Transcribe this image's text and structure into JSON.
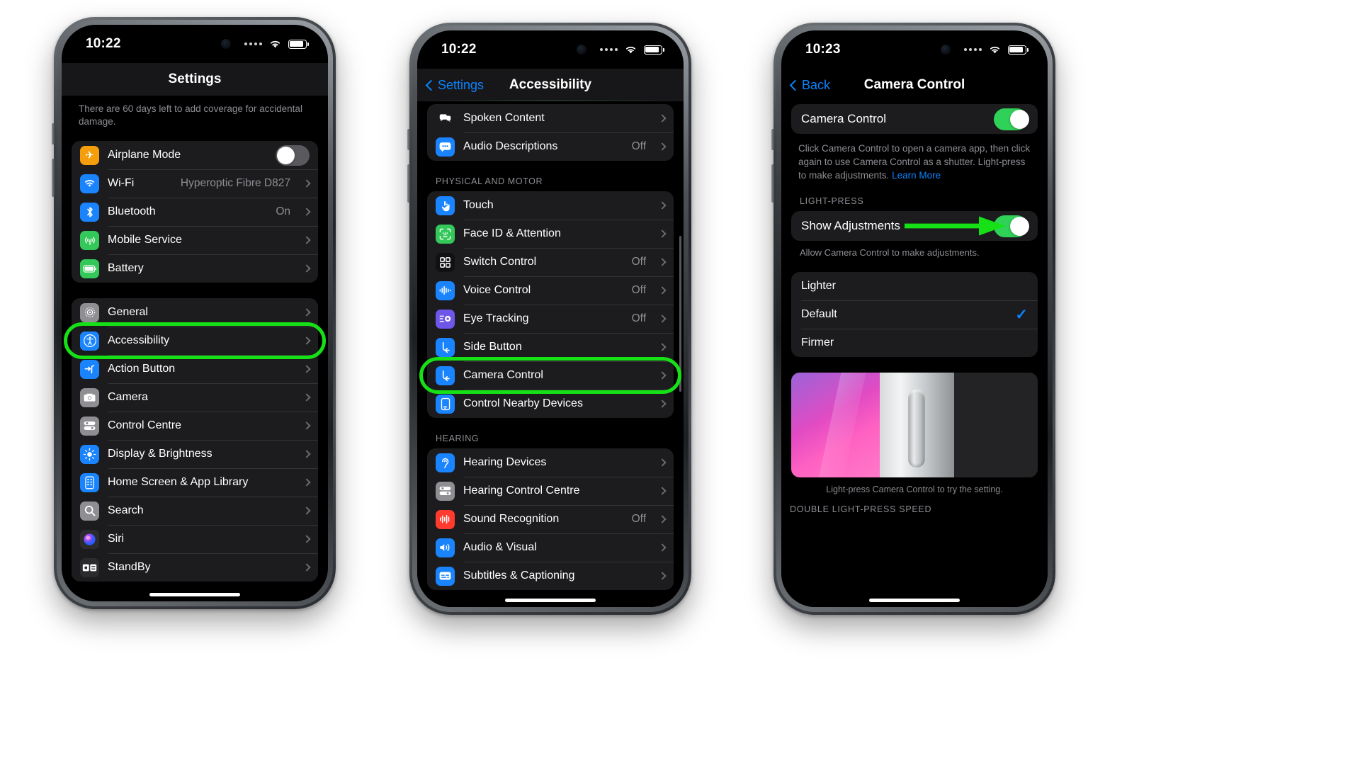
{
  "phone1": {
    "status": {
      "time": "10:22",
      "signal": "cellular-bars",
      "wifi": "wifi-icon",
      "battery": "battery-icon"
    },
    "nav": {
      "title": "Settings"
    },
    "footnote": "There are 60 days left to add coverage for accidental damage.",
    "group_a": [
      {
        "label": "Airplane Mode",
        "icon": "airplane-icon",
        "icon_color": "#f59e0b",
        "control": "toggle",
        "toggle_on": false
      },
      {
        "label": "Wi-Fi",
        "icon": "wifi-icon",
        "icon_color": "#1a84ff",
        "value": "Hyperoptic Fibre D827",
        "control": "chevron"
      },
      {
        "label": "Bluetooth",
        "icon": "bluetooth-icon",
        "icon_color": "#1a84ff",
        "value": "On",
        "control": "chevron"
      },
      {
        "label": "Mobile Service",
        "icon": "antenna-icon",
        "icon_color": "#34c759",
        "value": "",
        "control": "chevron"
      },
      {
        "label": "Battery",
        "icon": "battery-icon",
        "icon_color": "#34c759",
        "value": "",
        "control": "chevron"
      }
    ],
    "group_b": [
      {
        "label": "General",
        "icon": "gear-icon",
        "icon_color": "#8e8e93",
        "control": "chevron"
      },
      {
        "label": "Accessibility",
        "icon": "accessibility-icon",
        "icon_color": "#1a84ff",
        "control": "chevron",
        "highlighted": true
      },
      {
        "label": "Action Button",
        "icon": "action-button-icon",
        "icon_color": "#1a84ff",
        "control": "chevron"
      },
      {
        "label": "Camera",
        "icon": "camera-icon",
        "icon_color": "#8e8e93",
        "control": "chevron"
      },
      {
        "label": "Control Centre",
        "icon": "control-centre-icon",
        "icon_color": "#8e8e93",
        "control": "chevron"
      },
      {
        "label": "Display & Brightness",
        "icon": "brightness-icon",
        "icon_color": "#1a84ff",
        "control": "chevron"
      },
      {
        "label": "Home Screen & App Library",
        "icon": "home-screen-icon",
        "icon_color": "#1a84ff",
        "control": "chevron"
      },
      {
        "label": "Search",
        "icon": "search-icon",
        "icon_color": "#8e8e93",
        "control": "chevron"
      },
      {
        "label": "Siri",
        "icon": "siri-icon",
        "icon_color": "#2b2b2e",
        "control": "chevron"
      },
      {
        "label": "StandBy",
        "icon": "standby-icon",
        "icon_color": "#2b2b2e",
        "control": "chevron"
      }
    ]
  },
  "phone2": {
    "status": {
      "time": "10:22"
    },
    "nav": {
      "back": "Settings",
      "title": "Accessibility"
    },
    "group_top": [
      {
        "label": "Spoken Content",
        "icon": "spoken-content-icon",
        "icon_color": "#1c1c1e",
        "control": "chevron"
      },
      {
        "label": "Audio Descriptions",
        "icon": "audio-descriptions-icon",
        "icon_color": "#1a84ff",
        "value": "Off",
        "control": "chevron"
      }
    ],
    "section_physical": "PHYSICAL AND MOTOR",
    "group_physical": [
      {
        "label": "Touch",
        "icon": "touch-icon",
        "icon_color": "#1a84ff",
        "control": "chevron"
      },
      {
        "label": "Face ID & Attention",
        "icon": "face-id-icon",
        "icon_color": "#34c759",
        "control": "chevron"
      },
      {
        "label": "Switch Control",
        "icon": "switch-control-icon",
        "icon_color": "#111113",
        "value": "Off",
        "control": "chevron"
      },
      {
        "label": "Voice Control",
        "icon": "voice-control-icon",
        "icon_color": "#1a84ff",
        "value": "Off",
        "control": "chevron"
      },
      {
        "label": "Eye Tracking",
        "icon": "eye-tracking-icon",
        "icon_color": "#6e56e8",
        "value": "Off",
        "control": "chevron"
      },
      {
        "label": "Side Button",
        "icon": "side-button-icon",
        "icon_color": "#1a84ff",
        "control": "chevron"
      },
      {
        "label": "Camera Control",
        "icon": "camera-control-icon",
        "icon_color": "#1a84ff",
        "control": "chevron",
        "highlighted": true
      },
      {
        "label": "Control Nearby Devices",
        "icon": "control-nearby-devices-icon",
        "icon_color": "#1a84ff",
        "control": "chevron"
      }
    ],
    "section_hearing": "HEARING",
    "group_hearing": [
      {
        "label": "Hearing Devices",
        "icon": "hearing-devices-icon",
        "icon_color": "#1a84ff",
        "control": "chevron"
      },
      {
        "label": "Hearing Control Centre",
        "icon": "hearing-control-centre-icon",
        "icon_color": "#8e8e93",
        "control": "chevron"
      },
      {
        "label": "Sound Recognition",
        "icon": "sound-recognition-icon",
        "icon_color": "#ff3b30",
        "value": "Off",
        "control": "chevron"
      },
      {
        "label": "Audio & Visual",
        "icon": "audio-visual-icon",
        "icon_color": "#1a84ff",
        "control": "chevron"
      },
      {
        "label": "Subtitles & Captioning",
        "icon": "subtitles-icon",
        "icon_color": "#1a84ff",
        "control": "chevron"
      }
    ]
  },
  "phone3": {
    "status": {
      "time": "10:23"
    },
    "nav": {
      "back": "Back",
      "title": "Camera Control"
    },
    "main_toggle": {
      "label": "Camera Control",
      "on": true
    },
    "description": "Click Camera Control to open a camera app, then click again to use Camera Control as a shutter. Light-press to make adjustments. ",
    "description_link": "Learn More",
    "section_light_press": "LIGHT-PRESS",
    "show_adjustments": {
      "label": "Show Adjustments",
      "on": true
    },
    "show_adjustments_sub": "Allow Camera Control to make adjustments.",
    "options": [
      {
        "label": "Lighter",
        "selected": false
      },
      {
        "label": "Default",
        "selected": true
      },
      {
        "label": "Firmer",
        "selected": false
      }
    ],
    "preview_caption": "Light-press Camera Control to try the setting.",
    "section_double": "DOUBLE LIGHT-PRESS SPEED"
  },
  "annotations": {
    "accent_green": "#16e016",
    "highlight_accessibility": "ring",
    "highlight_camera_control": "ring",
    "arrow_show_adjustments": "arrow-right"
  }
}
